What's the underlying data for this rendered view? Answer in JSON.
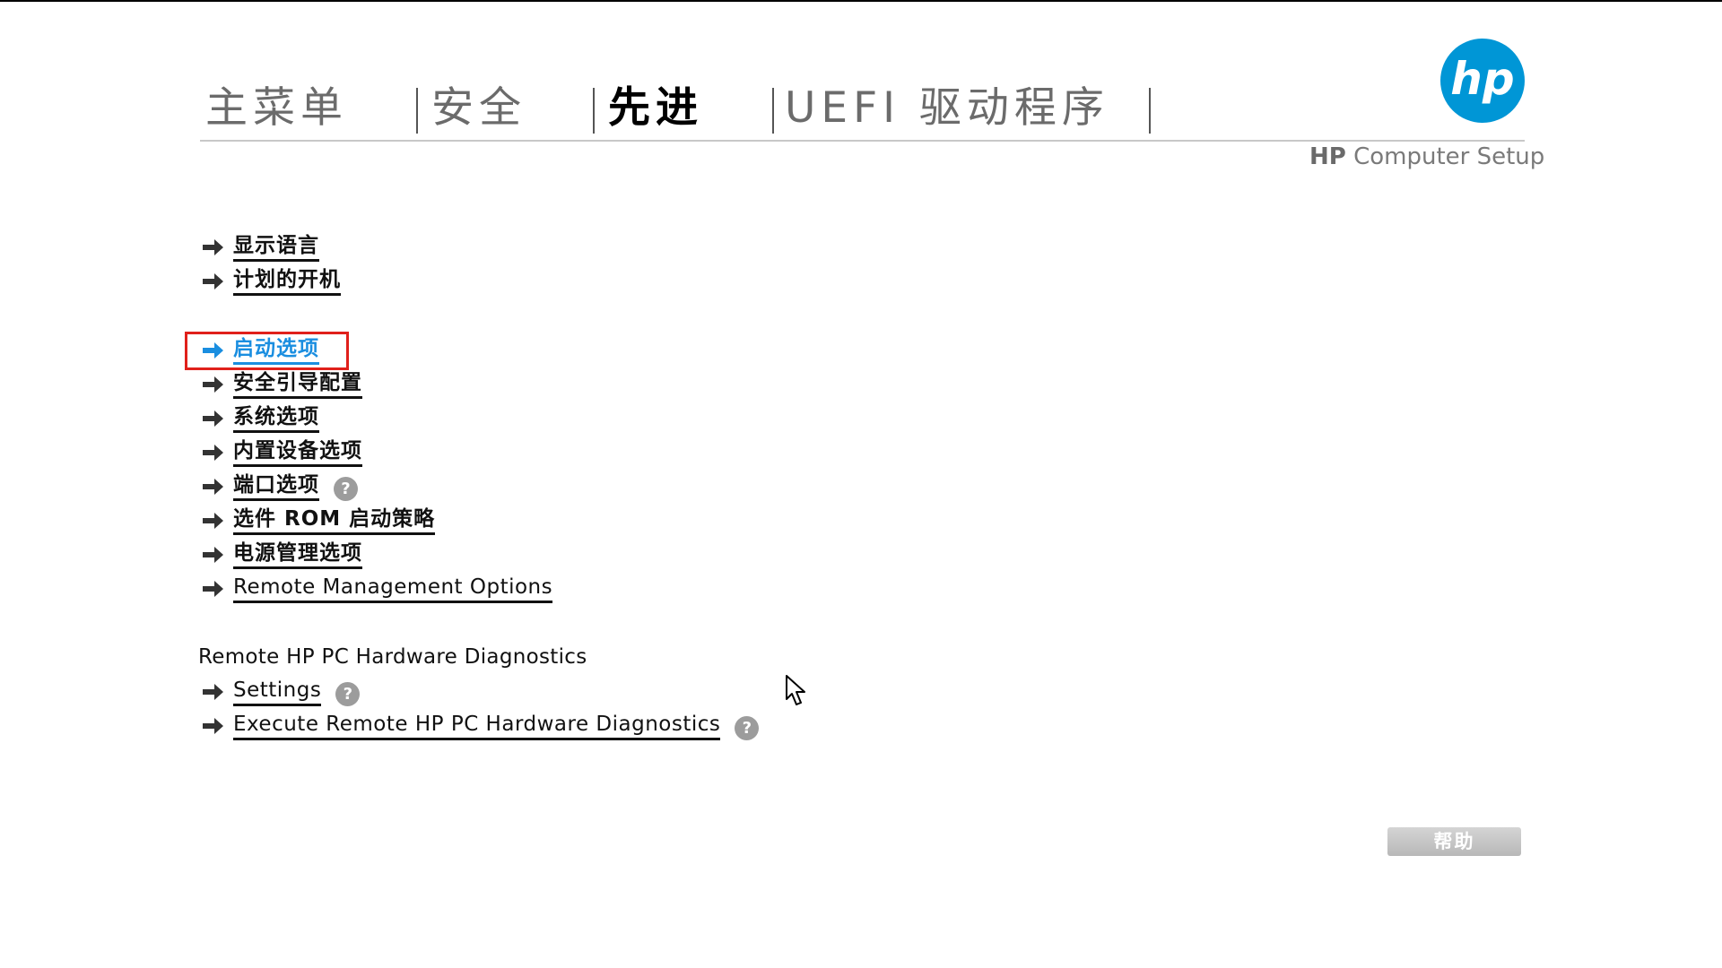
{
  "tabs": [
    {
      "label": "主菜单"
    },
    {
      "label": "安全"
    },
    {
      "label": "先进"
    },
    {
      "label": "UEFI 驱动程序"
    }
  ],
  "active_tab": "先进",
  "brand": {
    "bold": "HP",
    "caption": "Computer Setup",
    "logo_text": "hp",
    "logo_color": "#0096d6"
  },
  "menu": {
    "group1": [
      {
        "label": "显示语言"
      },
      {
        "label": "计划的开机"
      }
    ],
    "group2": [
      {
        "label": "启动选项",
        "selected": true
      },
      {
        "label": "安全引导配置"
      },
      {
        "label": "系统选项"
      },
      {
        "label": "内置设备选项"
      },
      {
        "label": "端口选项",
        "help": true
      },
      {
        "label": "选件 ROM 启动策略"
      },
      {
        "label": "电源管理选项"
      },
      {
        "label": "Remote Management Options"
      }
    ]
  },
  "diagnostics": {
    "heading": "Remote HP PC Hardware Diagnostics",
    "items": [
      {
        "label": "Settings",
        "help": true
      },
      {
        "label": "Execute Remote HP PC Hardware Diagnostics",
        "help": true
      }
    ]
  },
  "help_icon_glyph": "?",
  "help_button": {
    "label": "帮助"
  },
  "colors": {
    "selected": "#1a8ee0",
    "highlight_box": "#e0201b",
    "arrow": "#333333"
  },
  "icons": {
    "menu_arrow": "arrow-right-icon",
    "help": "question-mark-icon",
    "logo": "hp-logo-icon",
    "cursor": "mouse-pointer-icon"
  }
}
